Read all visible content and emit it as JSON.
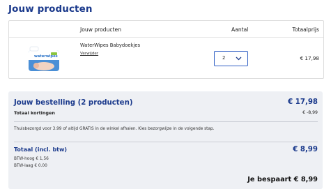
{
  "page": {
    "title": "Jouw producten"
  },
  "products_table": {
    "headers": {
      "product": "Jouw producten",
      "quantity": "Aantal",
      "total": "Totaalprijs"
    },
    "rows": [
      {
        "name": "WaterWipes Babydoekjes",
        "remove_label": "Verwijder",
        "quantity": "2",
        "price": "€ 17,98",
        "image_icon": "waterwipes-package-image",
        "image_brand_text": "waterwipes"
      }
    ]
  },
  "summary": {
    "order_title": "Jouw bestelling (2 producten)",
    "order_total": "€ 17,98",
    "discount_label": "Totaal kortingen",
    "discount_value": "€ -8,99",
    "delivery_note": "Thuisbezorgd voor 3.99 of altijd GRATIS in de winkel afhalen. Kies bezorgwijze in de volgende stap.",
    "total_incl_label": "Totaal (incl. btw)",
    "total_incl_value": "€ 8,99",
    "vat_high": "BTW-hoog € 1,56",
    "vat_low": "BTW-laag € 0.00",
    "savings": "Je bespaart € 8,99"
  },
  "colors": {
    "brand_blue": "#1b3a8c",
    "select_border": "#2f5fc4",
    "summary_bg": "#eef0f4"
  }
}
